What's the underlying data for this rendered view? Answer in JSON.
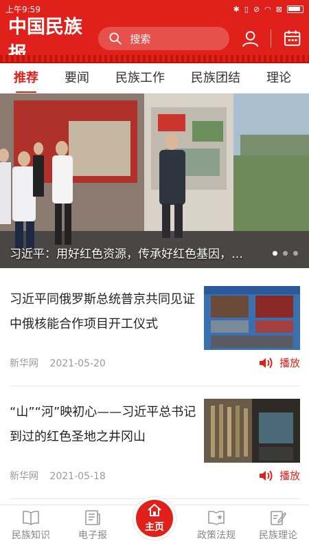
{
  "status_bar": {
    "time": "上午9:59"
  },
  "header": {
    "logo": "中国民族报",
    "search_placeholder": "搜索"
  },
  "tabs": [
    {
      "label": "推荐",
      "active": true
    },
    {
      "label": "要闻",
      "active": false
    },
    {
      "label": "民族工作",
      "active": false
    },
    {
      "label": "民族团结",
      "active": false
    },
    {
      "label": "理论",
      "active": false
    }
  ],
  "banner": {
    "caption": "习近平：用好红色资源，传承好红色基因，把红色江山世世代代传下去",
    "slide_count": 3,
    "active_slide": 1
  },
  "articles": [
    {
      "title": "习近平同俄罗斯总统普京共同见证中俄核能合作项目开工仪式",
      "source": "新华网",
      "date": "2021-05-20",
      "play_label": "播放"
    },
    {
      "title": "“山”“河”映初心——习近平总书记到过的红色圣地之井冈山",
      "source": "新华网",
      "date": "2021-05-18",
      "play_label": "播放"
    }
  ],
  "bottom_nav": [
    {
      "label": "民族知识",
      "icon": "book-icon"
    },
    {
      "label": "电子报",
      "icon": "newspaper-icon"
    },
    {
      "label": "主页",
      "icon": "home-icon",
      "active": true
    },
    {
      "label": "政策法规",
      "icon": "star-book-icon"
    },
    {
      "label": "民族理论",
      "icon": "edit-doc-icon"
    }
  ],
  "colors": {
    "brand_red": "#e0201a",
    "muted_text": "#999999"
  }
}
